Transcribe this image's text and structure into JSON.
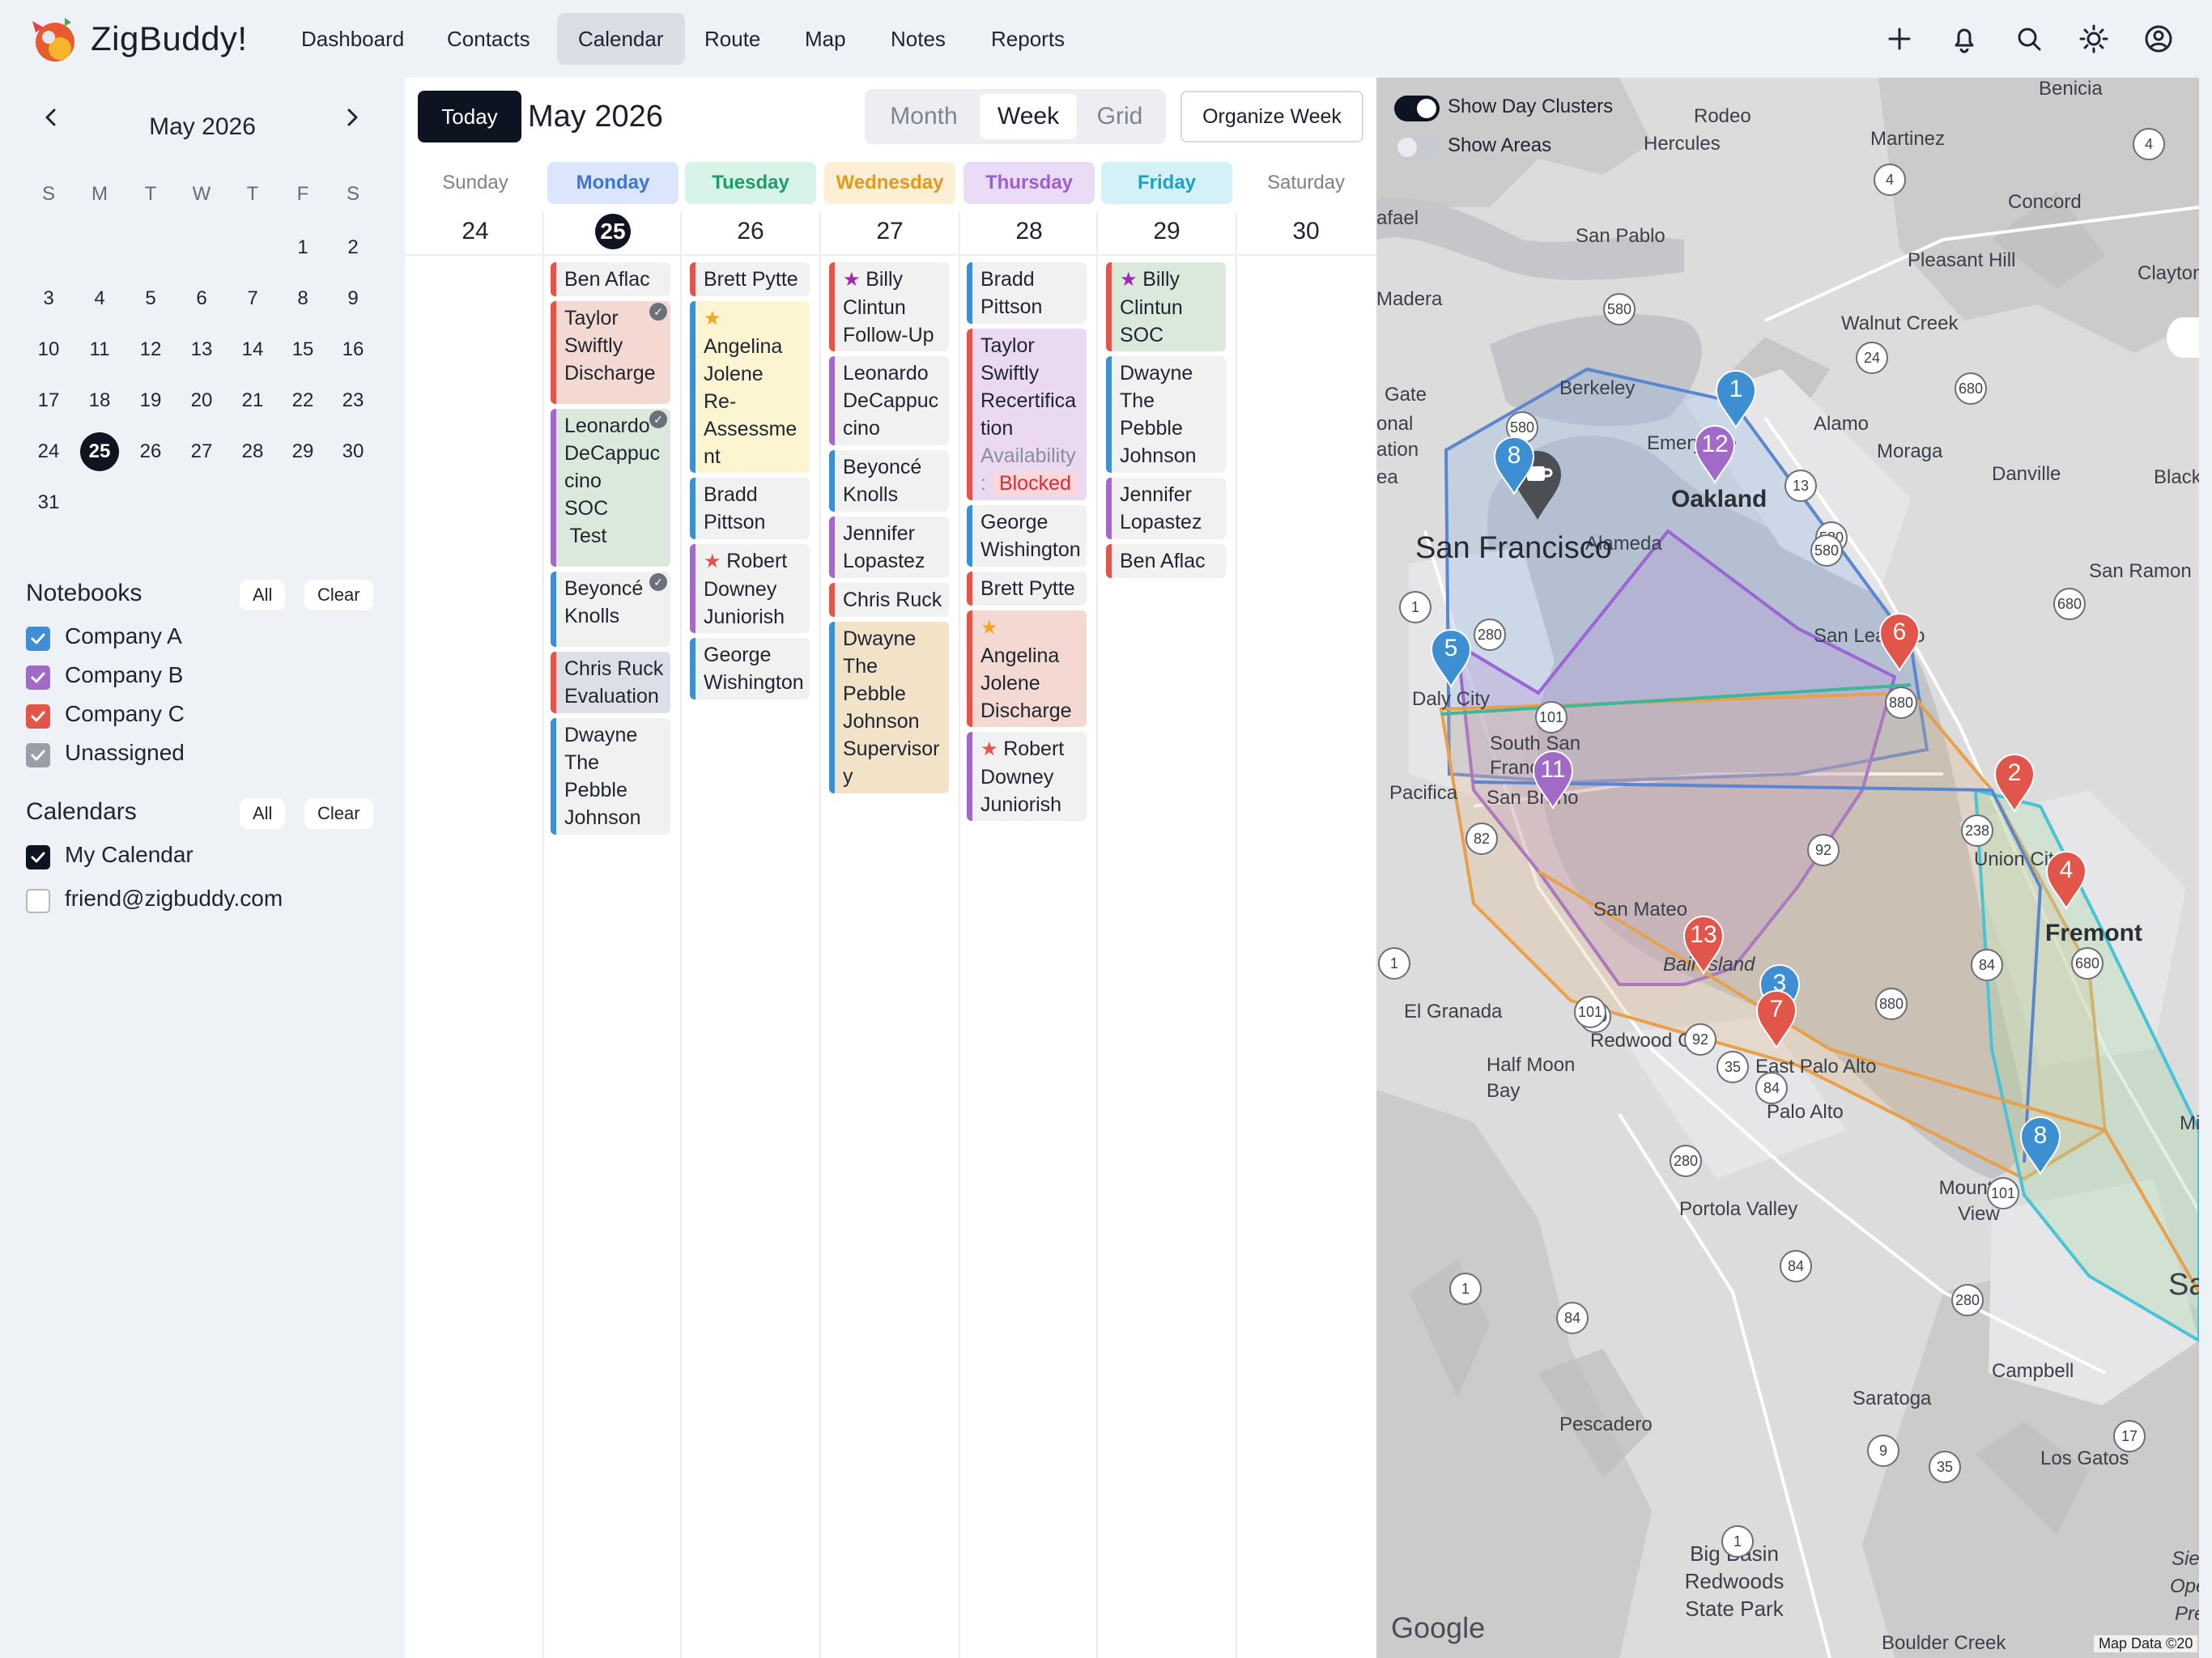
{
  "app": {
    "name": "ZigBuddy!",
    "logo_icon": "zigbuddy-logo"
  },
  "nav": {
    "items": [
      "Dashboard",
      "Contacts",
      "Calendar",
      "Route",
      "Map",
      "Notes",
      "Reports"
    ],
    "active": "Calendar"
  },
  "top_icons": [
    "plus-icon",
    "bell-icon",
    "search-icon",
    "sun-icon",
    "account-icon"
  ],
  "mini_calendar": {
    "title": "May 2026",
    "dow": [
      "S",
      "M",
      "T",
      "W",
      "T",
      "F",
      "S"
    ],
    "weeks": [
      [
        "",
        "",
        "",
        "",
        "",
        "1",
        "2"
      ],
      [
        "3",
        "4",
        "5",
        "6",
        "7",
        "8",
        "9"
      ],
      [
        "10",
        "11",
        "12",
        "13",
        "14",
        "15",
        "16"
      ],
      [
        "17",
        "18",
        "19",
        "20",
        "21",
        "22",
        "23"
      ],
      [
        "24",
        "25",
        "26",
        "27",
        "28",
        "29",
        "30"
      ],
      [
        "31",
        "",
        "",
        "",
        "",
        "",
        ""
      ]
    ],
    "today": "25"
  },
  "notebooks": {
    "title": "Notebooks",
    "all": "All",
    "clear": "Clear",
    "items": [
      {
        "label": "Company A",
        "color": "#3d8fd1",
        "checked": true
      },
      {
        "label": "Company B",
        "color": "#a26ac7",
        "checked": true
      },
      {
        "label": "Company C",
        "color": "#e2554a",
        "checked": true
      },
      {
        "label": "Unassigned",
        "color": "#9a9ea6",
        "checked": true
      }
    ]
  },
  "calendars": {
    "title": "Calendars",
    "all": "All",
    "clear": "Clear",
    "items": [
      {
        "label": "My Calendar",
        "checked": true,
        "color": "#0e1322"
      },
      {
        "label": "friend@zigbuddy.com",
        "checked": false,
        "color": "#ffffff"
      }
    ]
  },
  "calendar": {
    "today_label": "Today",
    "month_label": "May 2026",
    "views": [
      "Month",
      "Week",
      "Grid"
    ],
    "active_view": "Week",
    "organize_label": "Organize Week",
    "days": [
      {
        "name": "Sunday",
        "num": "24",
        "color": "#7b808a",
        "bg": "#ffffff"
      },
      {
        "name": "Monday",
        "num": "25",
        "color": "#3d74d6",
        "bg": "#dbe5fb"
      },
      {
        "name": "Tuesday",
        "num": "26",
        "color": "#1c9e6b",
        "bg": "#d8f3e7"
      },
      {
        "name": "Wednesday",
        "num": "27",
        "color": "#e39a1c",
        "bg": "#fcefd5"
      },
      {
        "name": "Thursday",
        "num": "28",
        "color": "#9c5fd0",
        "bg": "#eadcf7"
      },
      {
        "name": "Friday",
        "num": "29",
        "color": "#1aa3c7",
        "bg": "#d4f1f7"
      },
      {
        "name": "Saturday",
        "num": "30",
        "color": "#7b808a",
        "bg": "#ffffff"
      }
    ],
    "events": {
      "monday": [
        {
          "lines": [
            "Ben Aflac"
          ],
          "border": "#e2554a",
          "bg": "#f1f1f1"
        },
        {
          "lines": [
            "Taylor",
            "Swiftly",
            "Discharge"
          ],
          "border": "#e2554a",
          "bg": "#f4d9d3",
          "done": true
        },
        {
          "lines": [
            "Leonardo",
            "DeCappuc",
            "cino",
            "SOC",
            " Test"
          ],
          "border": "#a26ac7",
          "bg": "#dbe9dc",
          "done": true
        },
        {
          "lines": [
            "Beyoncé",
            "Knolls"
          ],
          "border": "#3d8fd1",
          "bg": "#f1f1f1",
          "done": true
        },
        {
          "lines": [
            "Chris Ruck",
            "Evaluation"
          ],
          "border": "#e2554a",
          "bg": "#dcdfe8"
        },
        {
          "lines": [
            "Dwayne",
            "The",
            "Pebble",
            "Johnson"
          ],
          "border": "#3d8fd1",
          "bg": "#f1f1f1"
        }
      ],
      "tuesday": [
        {
          "lines": [
            "Brett Pytte"
          ],
          "border": "#e2554a",
          "bg": "#f1f1f1"
        },
        {
          "lines": [
            "Angelina",
            "Jolene",
            "Re-",
            "Assessme",
            "nt"
          ],
          "border": "#3d8fd1",
          "bg": "#fdf5d2",
          "star": "#f4a623"
        },
        {
          "lines": [
            "Bradd",
            "Pittson"
          ],
          "border": "#3d8fd1",
          "bg": "#f1f1f1"
        },
        {
          "lines": [
            "Robert",
            "Downey",
            "Juniorish"
          ],
          "border": "#a26ac7",
          "bg": "#f1f1f1",
          "star": "#e2554a"
        },
        {
          "lines": [
            "George",
            "Wishington"
          ],
          "border": "#3d8fd1",
          "bg": "#f1f1f1"
        }
      ],
      "wednesday": [
        {
          "lines": [
            "Billy",
            "Clintun",
            "Follow-Up"
          ],
          "border": "#e2554a",
          "bg": "#f1f1f1",
          "star": "#a026b8"
        },
        {
          "lines": [
            "Leonardo",
            "DeCappuc",
            "cino"
          ],
          "border": "#a26ac7",
          "bg": "#f1f1f1"
        },
        {
          "lines": [
            "Beyoncé",
            "Knolls"
          ],
          "border": "#3d8fd1",
          "bg": "#f1f1f1"
        },
        {
          "lines": [
            "Jennifer",
            "Lopastez"
          ],
          "border": "#a26ac7",
          "bg": "#f1f1f1"
        },
        {
          "lines": [
            "Chris Ruck"
          ],
          "border": "#e2554a",
          "bg": "#f1f1f1"
        },
        {
          "lines": [
            "Dwayne",
            "The",
            "Pebble",
            "Johnson",
            "Supervisor",
            "y"
          ],
          "border": "#3d8fd1",
          "bg": "#f2e2c8"
        }
      ],
      "thursday": [
        {
          "lines": [
            "Bradd",
            "Pittson"
          ],
          "border": "#3d8fd1",
          "bg": "#f1f1f1"
        },
        {
          "lines": [
            "Taylor",
            "Swiftly",
            "Recertifica",
            "tion"
          ],
          "border": "#e2554a",
          "bg": "#ead9f0",
          "availability": "Availability",
          "avail_colon": ":",
          "blocked": "Blocked"
        },
        {
          "lines": [
            "George",
            "Wishington"
          ],
          "border": "#3d8fd1",
          "bg": "#f1f1f1"
        },
        {
          "lines": [
            "Brett Pytte"
          ],
          "border": "#e2554a",
          "bg": "#f1f1f1"
        },
        {
          "lines": [
            "Angelina",
            "Jolene",
            "Discharge"
          ],
          "border": "#e2554a",
          "bg": "#f4d9d3",
          "star": "#f4a623"
        },
        {
          "lines": [
            "Robert",
            "Downey",
            "Juniorish"
          ],
          "border": "#a26ac7",
          "bg": "#f1f1f1",
          "star": "#e2554a"
        }
      ],
      "friday": [
        {
          "lines": [
            "Billy",
            "Clintun",
            "SOC"
          ],
          "border": "#e2554a",
          "bg": "#dbe9dc",
          "star": "#a026b8"
        },
        {
          "lines": [
            "Dwayne",
            "The",
            "Pebble",
            "Johnson"
          ],
          "border": "#3d8fd1",
          "bg": "#f1f1f1"
        },
        {
          "lines": [
            "Jennifer",
            "Lopastez"
          ],
          "border": "#a26ac7",
          "bg": "#f1f1f1"
        },
        {
          "lines": [
            "Ben Aflac"
          ],
          "border": "#e2554a",
          "bg": "#f1f1f1"
        }
      ]
    }
  },
  "map": {
    "toggles": [
      {
        "label": "Show Day Clusters",
        "on": true
      },
      {
        "label": "Show Areas",
        "on": false
      }
    ],
    "places": {
      "big": [
        "San Francisco"
      ],
      "mid": [
        "Oakland",
        "Fremont"
      ],
      "small": [
        "Benicia",
        "Rodeo",
        "Hercules",
        "Martinez",
        "Concord",
        "San Pablo",
        "Pleasant Hill",
        "Clayton",
        "Madera",
        "Walnut Creek",
        "Berkeley",
        "Emeryville",
        "Alamo",
        "Moraga",
        "Danville",
        "Alameda",
        "San Ramon",
        "San Leandro",
        "Daly City",
        "South San Francisco",
        "Pacifica",
        "San Bruno",
        "Union City",
        "San Mateo",
        "Bair Island",
        "El Granada",
        "Redwood City",
        "East Palo Alto",
        "Half Moon Bay",
        "Palo Alto",
        "Mountain View",
        "Portola Valley",
        "Campbell",
        "Saratoga",
        "Los Gatos",
        "Pescadero",
        "Big Basin Redwoods State Park",
        "Boulder Creek",
        "Gate",
        "onal",
        "ation",
        "ea",
        "afael",
        "Black",
        "Sier",
        "Ope",
        "Pre",
        "Mi",
        "Sa"
      ]
    },
    "pins": [
      {
        "num": "1",
        "color": "#3d8fd1"
      },
      {
        "num": "12",
        "color": "#a26ac7"
      },
      {
        "num": "8",
        "color": "#3d8fd1"
      },
      {
        "num": "5",
        "color": "#3d8fd1"
      },
      {
        "num": "6",
        "color": "#e2554a"
      },
      {
        "num": "11",
        "color": "#a26ac7"
      },
      {
        "num": "2",
        "color": "#e2554a"
      },
      {
        "num": "4",
        "color": "#e2554a"
      },
      {
        "num": "13",
        "color": "#e2554a"
      },
      {
        "num": "3",
        "color": "#3d8fd1"
      },
      {
        "num": "7",
        "color": "#e2554a"
      },
      {
        "num": "8",
        "color": "#3d8fd1"
      }
    ],
    "shields": [
      "4",
      "4",
      "580",
      "24",
      "680",
      "13",
      "580",
      "680",
      "1",
      "280",
      "880",
      "101",
      "238",
      "82",
      "92",
      "84",
      "680",
      "880",
      "1",
      "280",
      "101",
      "92",
      "35",
      "84",
      "280",
      "101",
      "1",
      "84",
      "84",
      "280",
      "9",
      "35",
      "17",
      "1",
      "580",
      "580"
    ],
    "google": "Google",
    "map_data": "Map Data ©20"
  }
}
